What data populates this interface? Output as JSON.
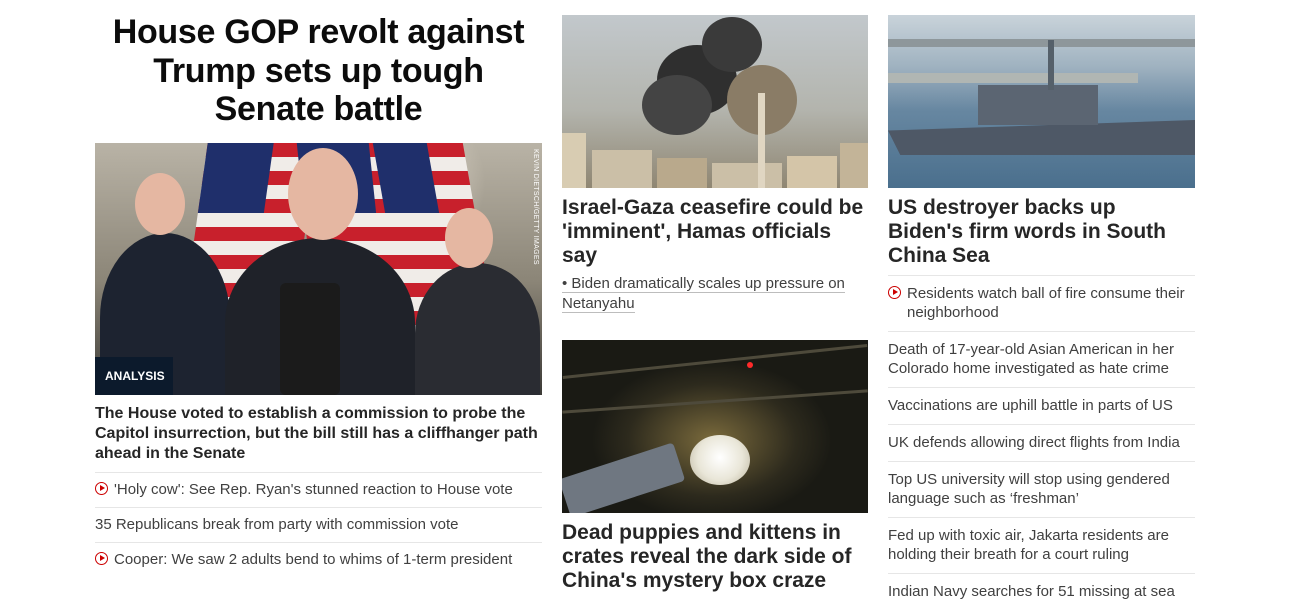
{
  "lead": {
    "headline": "House GOP revolt against Trump sets up tough Senate battle",
    "image_credit": "KEVIN DIETSCH/GETTY IMAGES",
    "badge": "ANALYSIS",
    "description": "The House voted to establish a commission to probe the Capitol insurrection, but the bill still has a cliffhanger path ahead in the Senate",
    "links": [
      {
        "text": "'Holy cow': See Rep. Ryan's stunned reaction to House vote",
        "video": true
      },
      {
        "text": "35 Republicans break from party with commission vote",
        "video": false
      },
      {
        "text": "Cooper: We saw 2 adults bend to whims of 1-term president",
        "video": true
      }
    ]
  },
  "middle": {
    "story1": {
      "title": "Israel-Gaza ceasefire could be 'imminent', Hamas officials say",
      "sub_link": "• Biden dramatically scales up pressure on Netanyahu"
    },
    "story2": {
      "title": "Dead puppies and kittens in crates reveal the dark side of China's mystery box craze"
    }
  },
  "right": {
    "title": "US destroyer backs up Biden's firm words in South China Sea",
    "links": [
      {
        "text": "Residents watch ball of fire consume their neighborhood",
        "video": true
      },
      {
        "text": "Death of 17-year-old Asian American in her Colorado home investigated as hate crime",
        "video": false
      },
      {
        "text": "Vaccinations are uphill battle in parts of US",
        "video": false
      },
      {
        "text": "UK defends allowing direct flights from India",
        "video": false
      },
      {
        "text": "Top US university will stop using gendered language such as ‘freshman’",
        "video": false
      },
      {
        "text": "Fed up with toxic air, Jakarta residents are holding their breath for a court ruling",
        "video": false
      },
      {
        "text": "Indian Navy searches for 51 missing at sea",
        "video": false
      }
    ]
  },
  "colors": {
    "accent": "#cc0000",
    "badge_bg": "#0c1a2c",
    "text": "#262626",
    "link_text": "#404040"
  }
}
